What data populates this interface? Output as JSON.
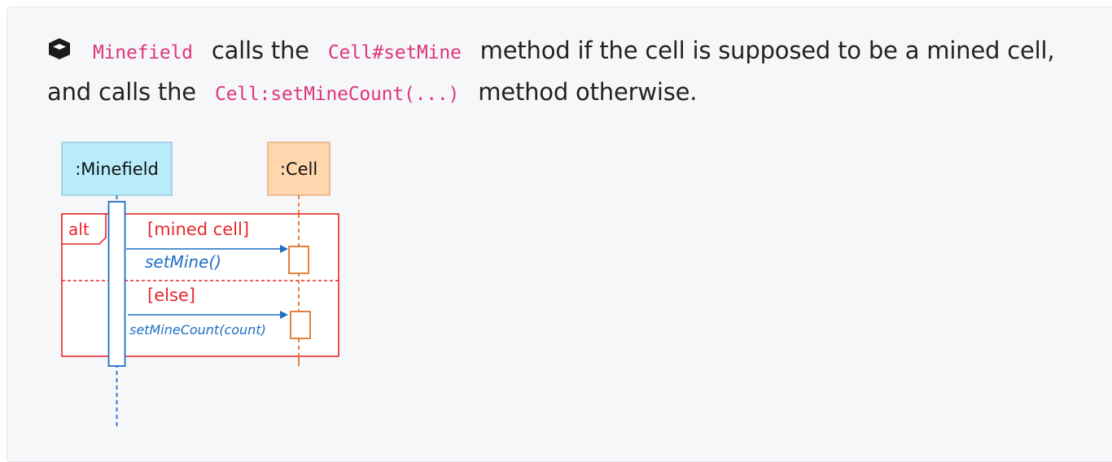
{
  "description": {
    "icon": "cube-icon",
    "part1_code": "Minefield",
    "part2": "calls the",
    "part3_code": "Cell#setMine",
    "part4": "method if the cell is supposed to be a mined cell, and calls the",
    "part5_code": "Cell:setMineCount(...)",
    "part6": "method otherwise."
  },
  "diagram": {
    "lifeline_minefield": ":Minefield",
    "lifeline_cell": ":Cell",
    "frame_label": "alt",
    "guard_1": "[mined cell]",
    "message_1": "setMine()",
    "guard_2": "[else]",
    "message_2": "setMineCount(count)"
  },
  "colors": {
    "code": "#e0357d",
    "frame": "#e8262b",
    "message": "#1f6fc4",
    "cell_activation": "#e0752a",
    "minefield_box": "#b6ecfb",
    "cell_box": "#ffd7b0"
  }
}
